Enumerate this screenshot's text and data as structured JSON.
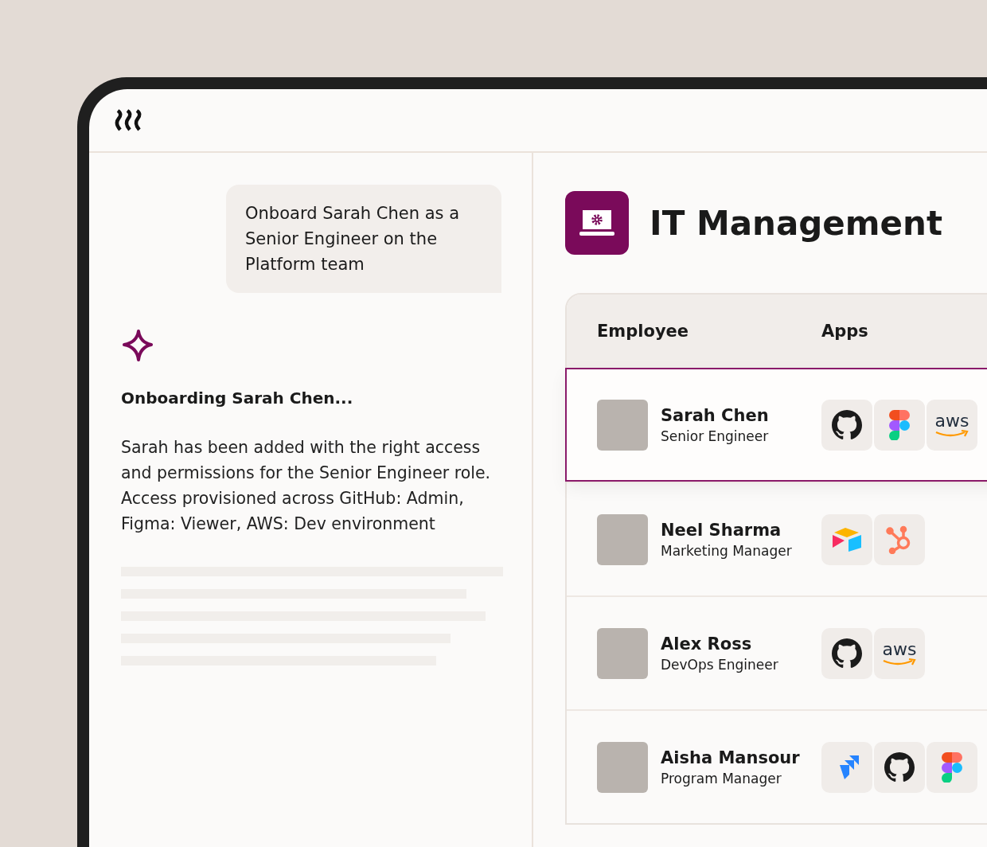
{
  "chat": {
    "user_message": "Onboard Sarah Chen as a Senior Engineer on the Platform team",
    "response_title": "Onboarding Sarah Chen...",
    "response_text": "Sarah has been added with the right access and permissions for the Senior Engineer role. Access provisioned across GitHub: Admin, Figma: Viewer, AWS: Dev environment"
  },
  "panel": {
    "title": "IT Management"
  },
  "table": {
    "columns": [
      "Employee",
      "Apps"
    ],
    "rows": [
      {
        "name": "Sarah Chen",
        "role": "Senior Engineer",
        "selected": true,
        "apps": [
          {
            "kind": "github"
          },
          {
            "kind": "figma"
          },
          {
            "kind": "aws",
            "label": "aws"
          }
        ]
      },
      {
        "name": "Neel Sharma",
        "role": "Marketing Manager",
        "selected": false,
        "apps": [
          {
            "kind": "airtable"
          },
          {
            "kind": "hubspot"
          }
        ]
      },
      {
        "name": "Alex Ross",
        "role": "DevOps Engineer",
        "selected": false,
        "apps": [
          {
            "kind": "github"
          },
          {
            "kind": "aws",
            "label": "aws"
          }
        ]
      },
      {
        "name": "Aisha Mansour",
        "role": "Program Manager",
        "selected": false,
        "apps": [
          {
            "kind": "jira"
          },
          {
            "kind": "github"
          },
          {
            "kind": "figma"
          }
        ]
      }
    ]
  }
}
